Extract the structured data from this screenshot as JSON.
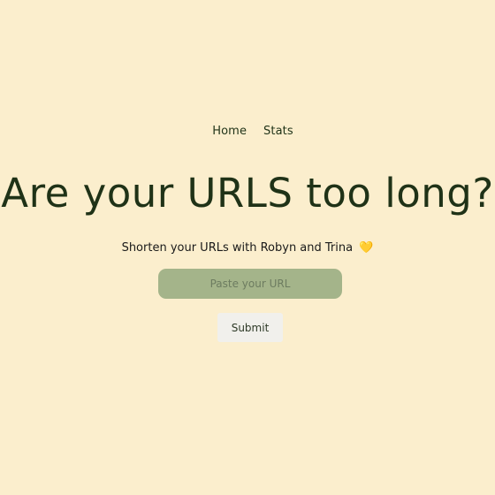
{
  "nav": {
    "items": [
      {
        "label": "Home"
      },
      {
        "label": "Stats"
      }
    ]
  },
  "hero": {
    "headline": "Are your URLS too long?",
    "subtitle": "Shorten your URLs with Robyn and Trina",
    "subtitle_emoji": "💛"
  },
  "form": {
    "url_placeholder": "Paste your URL",
    "url_value": "",
    "submit_label": "Submit"
  },
  "colors": {
    "background": "#fbeecd",
    "headline": "#1f3217",
    "input_background": "#a4b48a",
    "button_background": "#f1f0ec",
    "heart": "#f3b72c"
  }
}
